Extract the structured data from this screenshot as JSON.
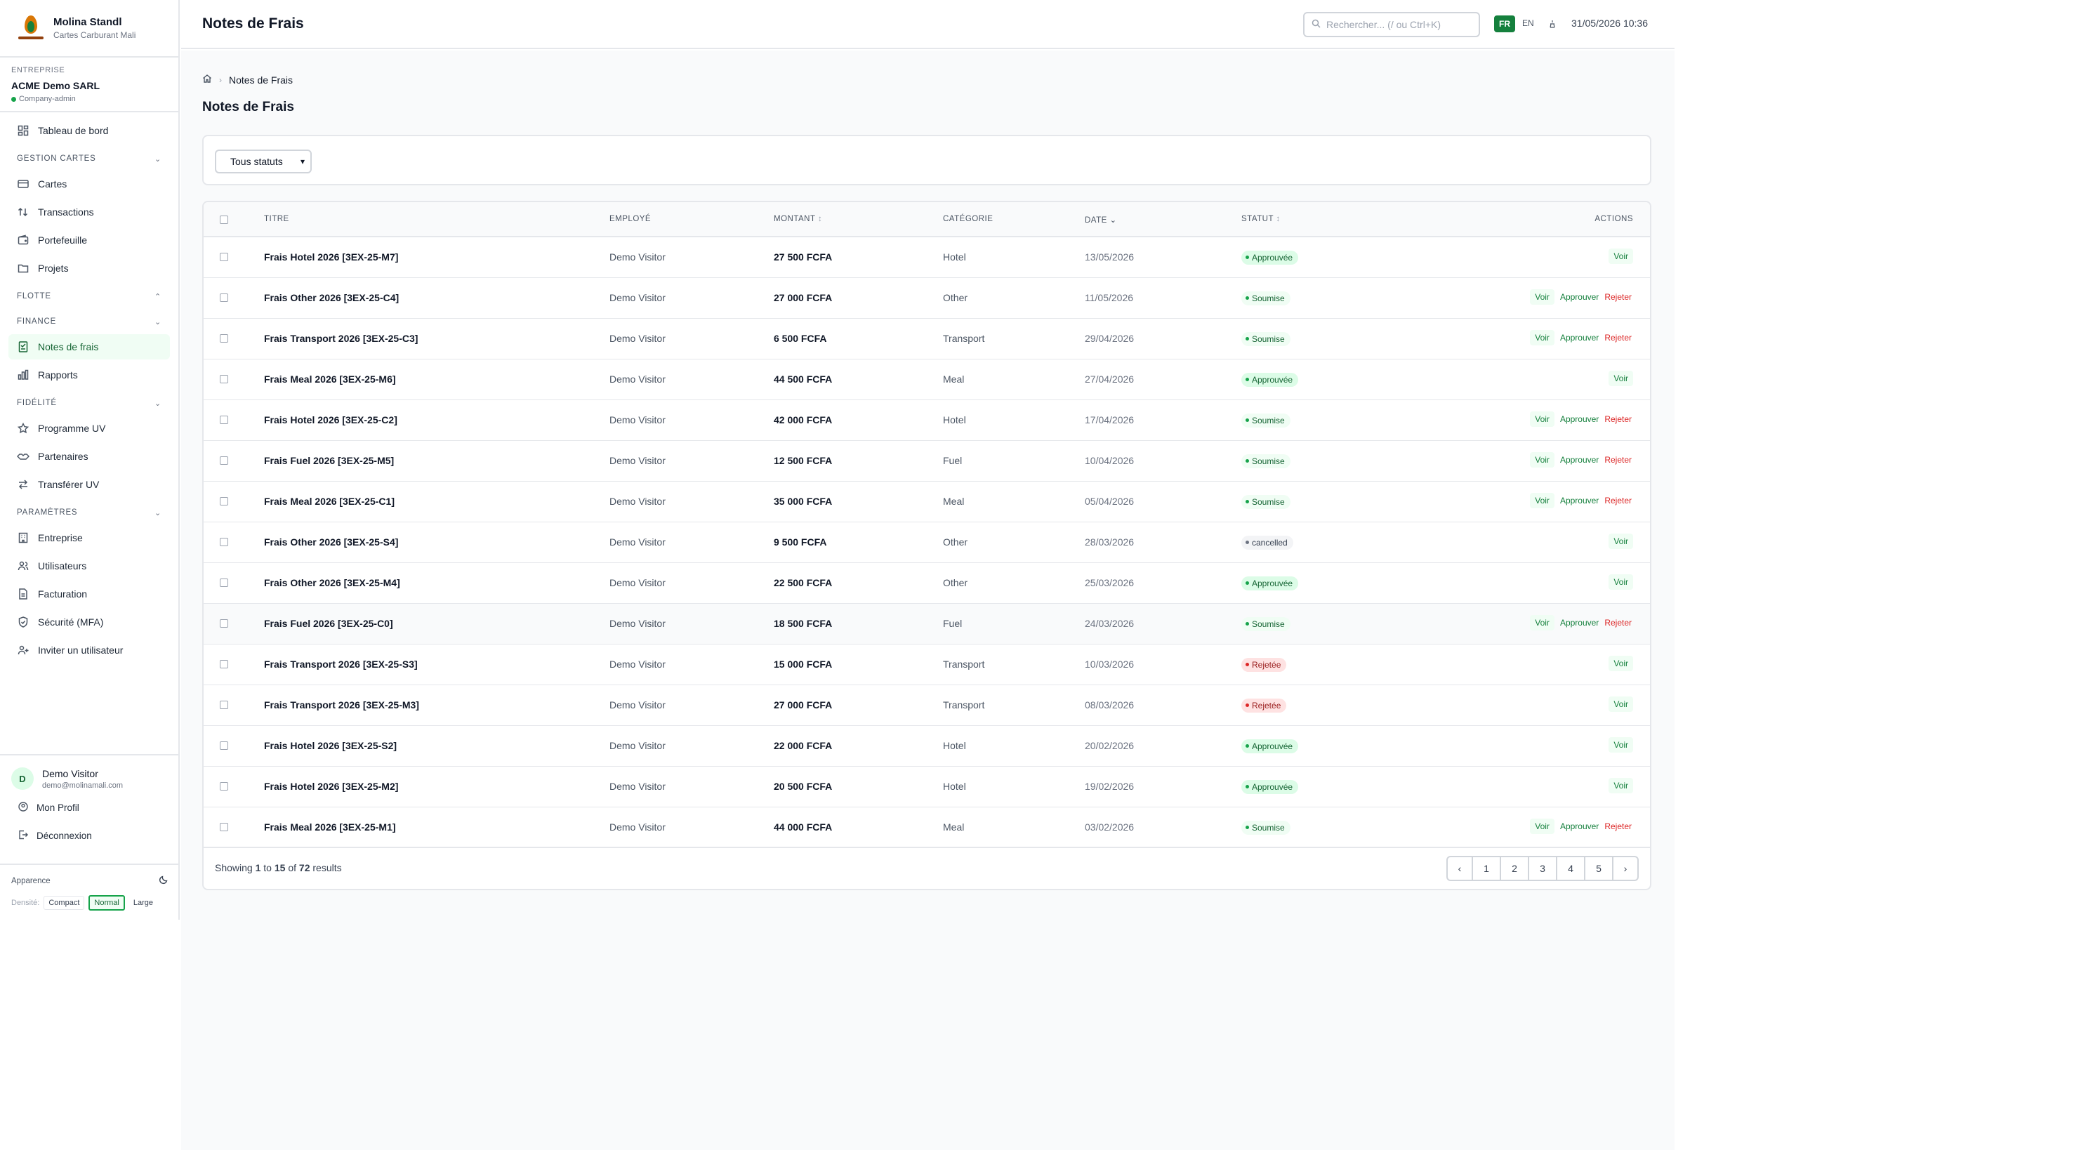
{
  "brand": {
    "name": "Molina Standl",
    "subtitle": "Cartes Carburant Mali"
  },
  "company": {
    "label": "ENTREPRISE",
    "name": "ACME Demo SARL",
    "role": "Company-admin"
  },
  "nav": {
    "dashboard": "Tableau de bord",
    "sec_cards": "GESTION CARTES",
    "cards": "Cartes",
    "transactions": "Transactions",
    "wallet": "Portefeuille",
    "projects": "Projets",
    "sec_fleet": "FLOTTE",
    "sec_finance": "FINANCE",
    "expenses": "Notes de frais",
    "reports": "Rapports",
    "sec_loyalty": "FIDÉLITÉ",
    "uv_program": "Programme UV",
    "partners": "Partenaires",
    "uv_transfer": "Transférer UV",
    "sec_settings": "PARAMÈTRES",
    "company": "Entreprise",
    "users": "Utilisateurs",
    "billing": "Facturation",
    "security": "Sécurité (MFA)",
    "invite": "Inviter un utilisateur"
  },
  "user": {
    "initial": "D",
    "name": "Demo Visitor",
    "email": "demo@molinamali.com",
    "profile": "Mon Profil",
    "logout": "Déconnexion"
  },
  "appearance": {
    "label": "Apparence",
    "density_label": "Densité:",
    "compact": "Compact",
    "normal": "Normal",
    "large": "Large"
  },
  "header": {
    "title": "Notes de Frais",
    "search_placeholder": "Rechercher... (/ ou Ctrl+K)",
    "lang_fr": "FR",
    "lang_en": "EN",
    "tz": "⌂",
    "datetime": "31/05/2026 10:36"
  },
  "breadcrumb": {
    "current": "Notes de Frais"
  },
  "page_title": "Notes de Frais",
  "filter": {
    "status": "Tous statuts"
  },
  "table": {
    "columns": {
      "title": "TITRE",
      "employee": "EMPLOYÉ",
      "amount": "MONTANT",
      "category": "CATÉGORIE",
      "date": "DATE",
      "status": "STATUT",
      "actions": "ACTIONS"
    },
    "actions": {
      "view": "Voir",
      "approve": "Approuver",
      "reject": "Rejeter"
    },
    "rows": [
      {
        "title": "Frais Hotel 2026 [3EX-25-M7]",
        "employee": "Demo Visitor",
        "amount": "27 500 FCFA",
        "category": "Hotel",
        "date": "13/05/2026",
        "status": "Approuvée",
        "kind": "approved"
      },
      {
        "title": "Frais Other 2026 [3EX-25-C4]",
        "employee": "Demo Visitor",
        "amount": "27 000 FCFA",
        "category": "Other",
        "date": "11/05/2026",
        "status": "Soumise",
        "kind": "submitted"
      },
      {
        "title": "Frais Transport 2026 [3EX-25-C3]",
        "employee": "Demo Visitor",
        "amount": "6 500 FCFA",
        "category": "Transport",
        "date": "29/04/2026",
        "status": "Soumise",
        "kind": "submitted"
      },
      {
        "title": "Frais Meal 2026 [3EX-25-M6]",
        "employee": "Demo Visitor",
        "amount": "44 500 FCFA",
        "category": "Meal",
        "date": "27/04/2026",
        "status": "Approuvée",
        "kind": "approved"
      },
      {
        "title": "Frais Hotel 2026 [3EX-25-C2]",
        "employee": "Demo Visitor",
        "amount": "42 000 FCFA",
        "category": "Hotel",
        "date": "17/04/2026",
        "status": "Soumise",
        "kind": "submitted"
      },
      {
        "title": "Frais Fuel 2026 [3EX-25-M5]",
        "employee": "Demo Visitor",
        "amount": "12 500 FCFA",
        "category": "Fuel",
        "date": "10/04/2026",
        "status": "Soumise",
        "kind": "submitted"
      },
      {
        "title": "Frais Meal 2026 [3EX-25-C1]",
        "employee": "Demo Visitor",
        "amount": "35 000 FCFA",
        "category": "Meal",
        "date": "05/04/2026",
        "status": "Soumise",
        "kind": "submitted"
      },
      {
        "title": "Frais Other 2026 [3EX-25-S4]",
        "employee": "Demo Visitor",
        "amount": "9 500 FCFA",
        "category": "Other",
        "date": "28/03/2026",
        "status": "cancelled",
        "kind": "cancelled"
      },
      {
        "title": "Frais Other 2026 [3EX-25-M4]",
        "employee": "Demo Visitor",
        "amount": "22 500 FCFA",
        "category": "Other",
        "date": "25/03/2026",
        "status": "Approuvée",
        "kind": "approved"
      },
      {
        "title": "Frais Fuel 2026 [3EX-25-C0]",
        "employee": "Demo Visitor",
        "amount": "18 500 FCFA",
        "category": "Fuel",
        "date": "24/03/2026",
        "status": "Soumise",
        "kind": "submitted"
      },
      {
        "title": "Frais Transport 2026 [3EX-25-S3]",
        "employee": "Demo Visitor",
        "amount": "15 000 FCFA",
        "category": "Transport",
        "date": "10/03/2026",
        "status": "Rejetée",
        "kind": "rejected"
      },
      {
        "title": "Frais Transport 2026 [3EX-25-M3]",
        "employee": "Demo Visitor",
        "amount": "27 000 FCFA",
        "category": "Transport",
        "date": "08/03/2026",
        "status": "Rejetée",
        "kind": "rejected"
      },
      {
        "title": "Frais Hotel 2026 [3EX-25-S2]",
        "employee": "Demo Visitor",
        "amount": "22 000 FCFA",
        "category": "Hotel",
        "date": "20/02/2026",
        "status": "Approuvée",
        "kind": "approved"
      },
      {
        "title": "Frais Hotel 2026 [3EX-25-M2]",
        "employee": "Demo Visitor",
        "amount": "20 500 FCFA",
        "category": "Hotel",
        "date": "19/02/2026",
        "status": "Approuvée",
        "kind": "approved"
      },
      {
        "title": "Frais Meal 2026 [3EX-25-M1]",
        "employee": "Demo Visitor",
        "amount": "44 000 FCFA",
        "category": "Meal",
        "date": "03/02/2026",
        "status": "Soumise",
        "kind": "submitted"
      }
    ]
  },
  "pagination": {
    "prefix": "Showing",
    "from": "1",
    "to_word": "to",
    "to": "15",
    "of_word": "of",
    "total": "72",
    "suffix": "results",
    "pages": [
      "1",
      "2",
      "3",
      "4",
      "5"
    ],
    "prev": "‹",
    "next": "›"
  }
}
